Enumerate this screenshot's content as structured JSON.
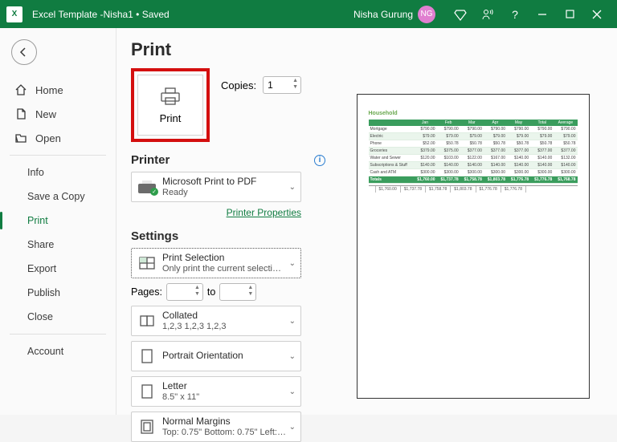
{
  "titlebar": {
    "doc_title": "Excel Template -Nisha1 • Saved",
    "user_name": "Nisha Gurung",
    "user_initials": "NG"
  },
  "sidebar": {
    "home": "Home",
    "new": "New",
    "open": "Open",
    "info": "Info",
    "save_copy": "Save a Copy",
    "print": "Print",
    "share": "Share",
    "export": "Export",
    "publish": "Publish",
    "close": "Close",
    "account": "Account"
  },
  "print": {
    "title": "Print",
    "print_btn": "Print",
    "copies_label": "Copies:",
    "copies_value": "1",
    "printer_head": "Printer",
    "printer_name": "Microsoft Print to PDF",
    "printer_status": "Ready",
    "printer_props": "Printer Properties",
    "settings_head": "Settings",
    "scope_l1": "Print Selection",
    "scope_l2": "Only print the current selecti…",
    "pages_label": "Pages:",
    "pages_to": "to",
    "collate_l1": "Collated",
    "collate_l2": "1,2,3    1,2,3    1,2,3",
    "orient_l1": "Portrait Orientation",
    "paper_l1": "Letter",
    "paper_l2": "8.5\" x 11\"",
    "margin_l1": "Normal Margins",
    "margin_l2": "Top: 0.75\" Bottom: 0.75\" Left:…"
  },
  "preview": {
    "title": "Household",
    "headers": [
      "",
      "Jan",
      "Feb",
      "Mar",
      "Apr",
      "May",
      "Total",
      "Average"
    ],
    "rows": [
      [
        "Mortgage",
        "$790.00",
        "$790.00",
        "$790.00",
        "$790.00",
        "$790.00",
        "$790.00",
        "$790.00"
      ],
      [
        "Electric",
        "$79.00",
        "$79.00",
        "$79.00",
        "$79.00",
        "$79.00",
        "$79.00",
        "$79.00"
      ],
      [
        "Phone",
        "$52.00",
        "$50.78",
        "$50.78",
        "$50.78",
        "$50.78",
        "$50.78",
        "$50.78"
      ],
      [
        "Groceries",
        "$379.00",
        "$375.00",
        "$377.00",
        "$377.00",
        "$377.00",
        "$377.00",
        "$377.00"
      ],
      [
        "Water and Sewer",
        "$120.00",
        "$103.00",
        "$122.00",
        "$167.00",
        "$140.00",
        "$140.00",
        "$132.00"
      ],
      [
        "Subscriptions & Stuff",
        "$140.00",
        "$140.00",
        "$140.00",
        "$140.00",
        "$140.00",
        "$140.00",
        "$140.00"
      ],
      [
        "Cash and ATM",
        "$300.00",
        "$300.00",
        "$300.00",
        "$300.00",
        "$300.00",
        "$300.00",
        "$300.00"
      ],
      [
        "Totals",
        "$1,760.00",
        "$1,737.78",
        "$1,758.78",
        "$1,803.78",
        "$1,776.78",
        "$1,776.78",
        "$1,768.78"
      ]
    ],
    "bottom": [
      "",
      "$1,760.00",
      "$1,737.78",
      "$1,758.78",
      "$1,803.78",
      "$1,776.78",
      "$1,776.78"
    ]
  }
}
